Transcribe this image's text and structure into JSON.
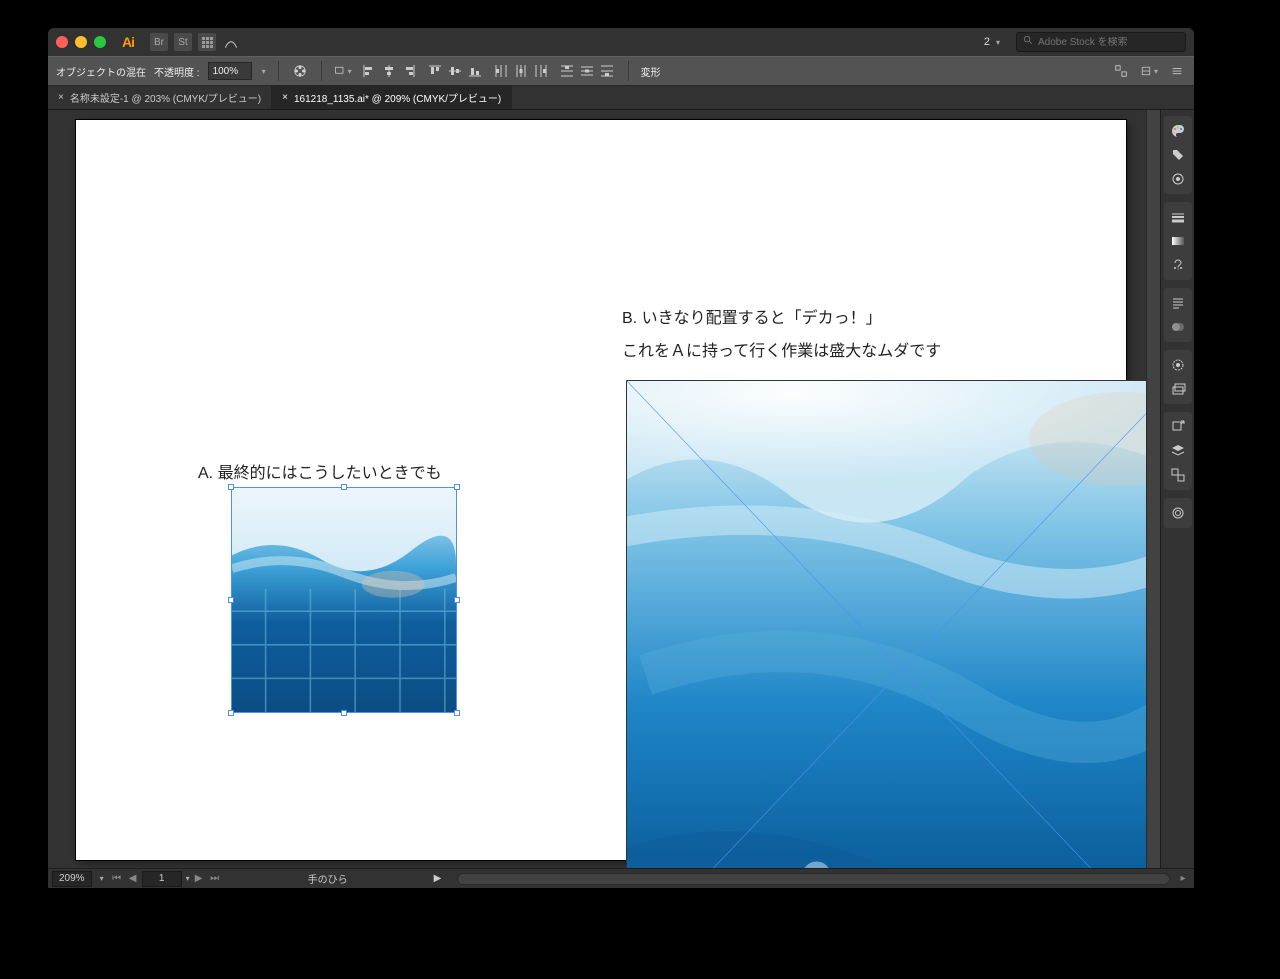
{
  "titlebar": {
    "workspace_label": "2",
    "search_placeholder": "Adobe Stock を検索"
  },
  "controlbar": {
    "blend_label": "オブジェクトの混在",
    "opacity_label": "不透明度 :",
    "opacity_value": "100%",
    "transform_label": "変形"
  },
  "tabs": [
    {
      "label": "名称未設定-1 @ 203% (CMYK/プレビュー)"
    },
    {
      "label": "161218_1135.ai* @ 209% (CMYK/プレビュー)"
    }
  ],
  "canvas": {
    "text_a": "A. 最終的にはこうしたいときでも",
    "text_b_line1": "B. いきなり配置すると「デカっ！」",
    "text_b_line2": "これをＡに持って行く作業は盛大なムダです"
  },
  "status": {
    "zoom": "209%",
    "page": "1",
    "tool": "手のひら"
  }
}
